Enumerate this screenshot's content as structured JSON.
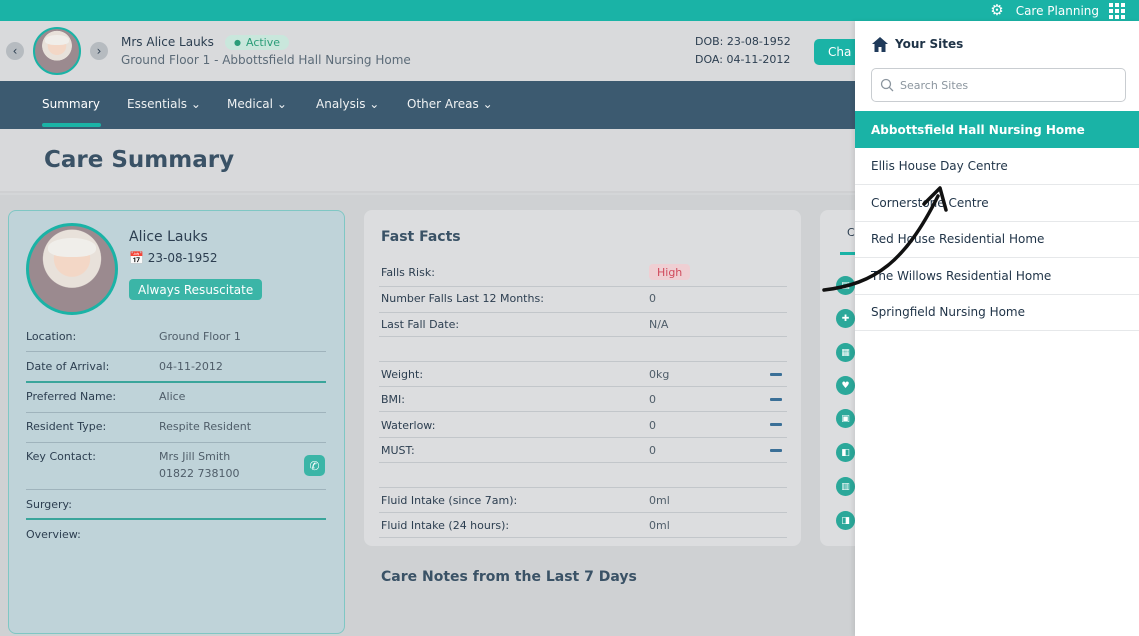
{
  "topbar": {
    "label": "Care Planning",
    "gear_icon": "gear-icon",
    "apps_icon": "grid-apps-icon"
  },
  "header": {
    "name": "Mrs Alice Lauks",
    "status": "Active",
    "location": "Ground Floor 1 - Abbottsfield Hall Nursing Home",
    "dob": "DOB: 23-08-1952",
    "doa": "DOA: 04-11-2012",
    "button_label": "Cha"
  },
  "nav": {
    "items": [
      {
        "label": "Summary"
      },
      {
        "label": "Essentials"
      },
      {
        "label": "Medical"
      },
      {
        "label": "Analysis"
      },
      {
        "label": "Other Areas"
      }
    ]
  },
  "page_title": "Care Summary",
  "resident": {
    "name": "Alice Lauks",
    "dob": "23-08-1952",
    "badge": "Always Resuscitate",
    "rows": [
      {
        "label": "Location:",
        "value": "Ground Floor 1"
      },
      {
        "label": "Date of Arrival:",
        "value": "04-11-2012"
      },
      {
        "label": "Preferred Name:",
        "value": "Alice"
      },
      {
        "label": "Resident Type:",
        "value": "Respite Resident"
      },
      {
        "label": "Key Contact:",
        "value": "Mrs Jill Smith",
        "value2": "01822 738100"
      },
      {
        "label": "Surgery:",
        "value": ""
      },
      {
        "label": "Overview:",
        "value": ""
      }
    ]
  },
  "fast_facts": {
    "title": "Fast Facts",
    "rows": [
      {
        "label": "Falls Risk:",
        "value": "High"
      },
      {
        "label": "Number Falls Last 12 Months:",
        "value": "0"
      },
      {
        "label": "Last Fall Date:",
        "value": "N/A"
      },
      {
        "label": "Weight:",
        "value": "0kg"
      },
      {
        "label": "BMI:",
        "value": "0"
      },
      {
        "label": "Waterlow:",
        "value": "0"
      },
      {
        "label": "MUST:",
        "value": "0"
      },
      {
        "label": "Fluid Intake (since 7am):",
        "value": "0ml"
      },
      {
        "label": "Fluid Intake (24 hours):",
        "value": "0ml"
      }
    ]
  },
  "care_notes_title": "Care Notes from the Last 7 Days",
  "right_card": {
    "tab": "C"
  },
  "sites_panel": {
    "title": "Your Sites",
    "search_placeholder": "Search Sites",
    "sites": [
      {
        "label": "Abbottsfield Hall Nursing Home",
        "active": true
      },
      {
        "label": "Ellis House Day Centre"
      },
      {
        "label": "Cornerstone Centre"
      },
      {
        "label": "Red House Residential Home"
      },
      {
        "label": "The Willows Residential Home"
      },
      {
        "label": "Springfield Nursing Home"
      }
    ]
  },
  "colors": {
    "brand": "#1ab3a6",
    "nav": "#3c5a70",
    "danger": "#d04a5c"
  }
}
